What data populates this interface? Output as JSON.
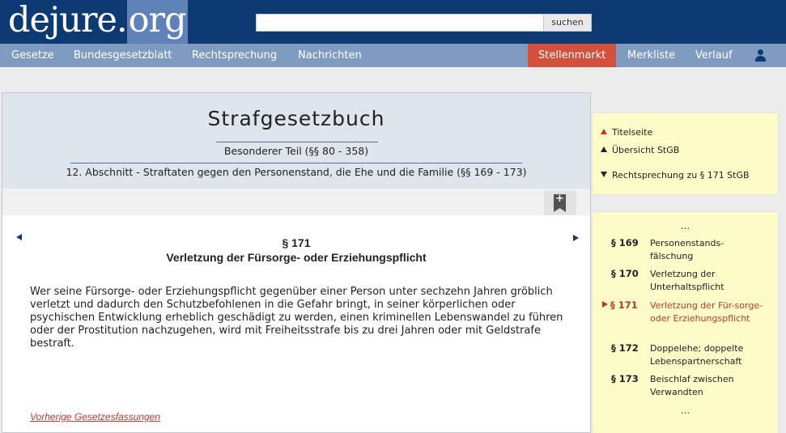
{
  "header": {
    "logo_part1": "dejure.",
    "logo_part2": "org",
    "search_placeholder": "",
    "search_button": "suchen"
  },
  "nav": {
    "items": [
      "Gesetze",
      "Bundesgesetzblatt",
      "Rechtsprechung",
      "Nachrichten",
      "Stellenmarkt",
      "Merkliste",
      "Verlauf"
    ],
    "user_icon": "user-icon",
    "highlight_color": "#d2503c"
  },
  "law": {
    "title": "Strafgesetzbuch",
    "part": "Besonderer Teil (§§ 80 - 358)",
    "section": "12. Abschnitt - Straftaten gegen den Personenstand, die Ehe und die Familie (§§ 169 - 173)"
  },
  "paragraph": {
    "number": "§ 171",
    "title": "Verletzung der Fürsorge- oder Erziehungspflicht",
    "text": "Wer seine Fürsorge- oder Erziehungspflicht gegenüber einer Person unter sechzehn Jahren gröblich verletzt und dadurch den Schutzbefohlenen in die Gefahr bringt, in seiner körperlichen oder psychischen Entwicklung erheblich geschädigt zu werden, einen kriminellen Lebenswandel zu führen oder der Prostitution nachzugehen, wird mit Freiheitsstrafe bis zu drei Jahren oder mit Geldstrafe bestraft.",
    "prev_versions": "Vorherige Gesetzesfassungen"
  },
  "side_links": {
    "titelseite": "Titelseite",
    "uebersicht": "Übersicht StGB",
    "rechtsprechung": "Rechtsprechung zu § 171 StGB"
  },
  "toc": {
    "ellipsis": "...",
    "entries": [
      {
        "num": "§ 169",
        "text": "Personenstands-fälschung"
      },
      {
        "num": "§ 170",
        "text": "Verletzung der Unterhaltspflicht"
      },
      {
        "num": "§ 171",
        "text": "Verletzung der Für-sorge- oder Erziehungspflicht"
      },
      {
        "num": "§ 172",
        "text": "Doppelehe; doppelte Lebenspartnerschaft"
      },
      {
        "num": "§ 173",
        "text": "Beischlaf zwischen Verwandten"
      }
    ]
  }
}
